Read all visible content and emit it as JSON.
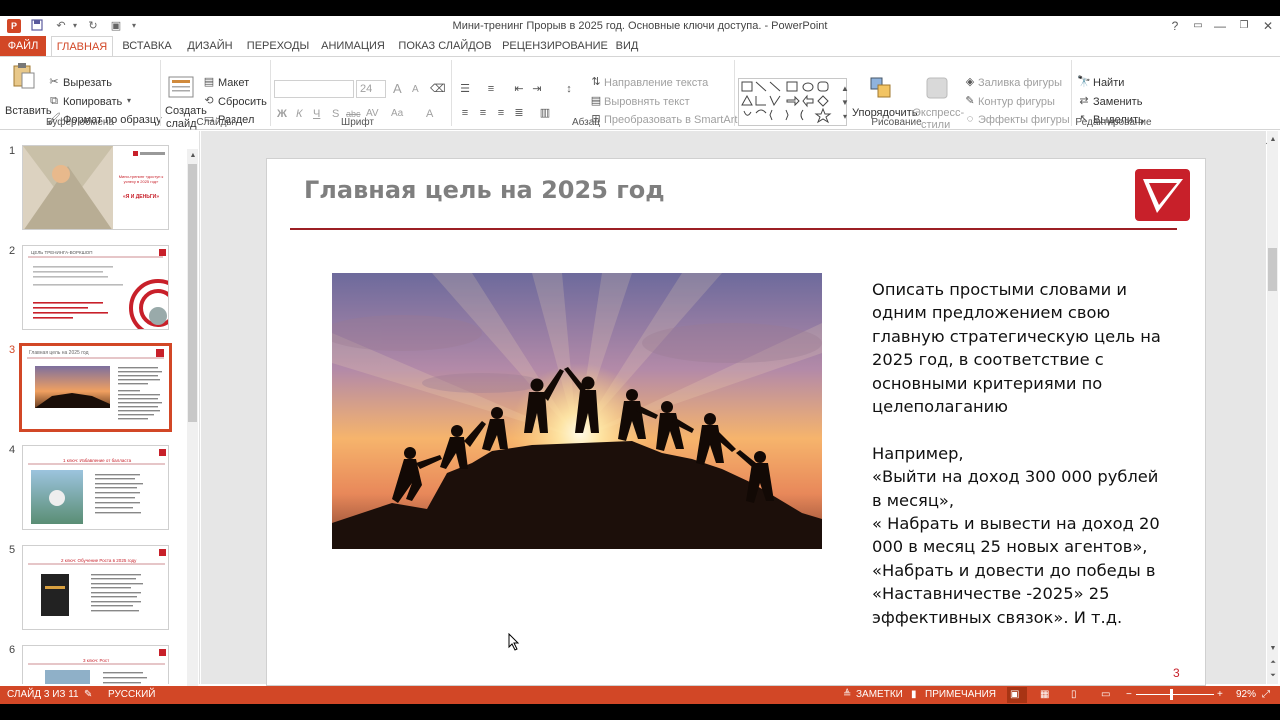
{
  "window": {
    "title": "Мини-тренинг Прорыв в 2025 год. Основные ключи доступа. - PowerPoint",
    "help": "?"
  },
  "tabs": {
    "file": "ФАЙЛ",
    "items": [
      "ГЛАВНАЯ",
      "ВСТАВКА",
      "ДИЗАЙН",
      "ПЕРЕХОДЫ",
      "АНИМАЦИЯ",
      "ПОКАЗ СЛАЙДОВ",
      "РЕЦЕНЗИРОВАНИЕ",
      "ВИД"
    ]
  },
  "ribbon": {
    "clipboard": {
      "paste": "Вставить",
      "cut": "Вырезать",
      "copy": "Копировать",
      "format_painter": "Формат по образцу",
      "label": "Буфер обмена"
    },
    "slides": {
      "new_slide_1": "Создать",
      "new_slide_2": "слайд",
      "layout": "Макет",
      "reset": "Сбросить",
      "section": "Раздел",
      "label": "Слайды"
    },
    "font": {
      "size": "24",
      "bold": "Ж",
      "italic": "К",
      "underline": "Ч",
      "shadow": "S",
      "strike": "abc",
      "spacing": "AV",
      "case": "Aa",
      "color": "A",
      "grow": "A",
      "shrink": "A",
      "label": "Шрифт"
    },
    "paragraph": {
      "text_direction": "Направление текста",
      "align_text": "Выровнять текст",
      "smartart": "Преобразовать в SmartArt",
      "label": "Абзац"
    },
    "drawing": {
      "arrange": "Упорядочить",
      "quick_styles_1": "Экспресс-",
      "quick_styles_2": "стили",
      "shape_fill": "Заливка фигуры",
      "shape_outline": "Контур фигуры",
      "shape_effects": "Эффекты фигуры",
      "label": "Рисование"
    },
    "editing": {
      "find": "Найти",
      "replace": "Заменить",
      "select": "Выделить",
      "label": "Редактирование"
    }
  },
  "thumbnails": {
    "numbers": [
      "1",
      "2",
      "3",
      "4",
      "5",
      "6"
    ],
    "active_index": 3,
    "t1": {
      "heading": "Мини-тренинг «доступ к успеху в 2025 год»",
      "caption": "«Я И ДЕНЬГИ»"
    },
    "t2": {
      "heading": "ЦЕЛЬ ТРЕНИНГА-ВОРКШОП"
    },
    "t3": {
      "heading": "Главная цель на 2025 год"
    },
    "t4": {
      "heading": "1 ключ: Избавление от балласта"
    },
    "t5": {
      "heading": "2 ключ: Обучение Роста в 2025 году"
    },
    "t6": {
      "heading": "3 ключ: Рост"
    }
  },
  "slide": {
    "title": "Главная цель на 2025 год",
    "body": "Описать простыми словами и одним предложением свою главную стратегическую цель на 2025 год, в соответствие с основными критериями по целеполаганию\n\nНапример,\n «Выйти на доход 300 000 рублей в месяц»,\n« Набрать и вывести на доход 20 000 в месяц 25 новых агентов»,\n«Набрать и довести до победы в «Наставничестве -2025» 25 эффективных связок». И т.д.",
    "number": "3"
  },
  "status": {
    "slide_of": "СЛАЙД 3 ИЗ 11",
    "language": "РУССКИЙ",
    "notes": "ЗАМЕТКИ",
    "comments": "ПРИМЕЧАНИЯ",
    "zoom": "92%"
  },
  "colors": {
    "accent": "#d24726",
    "slide_red": "#c8202a",
    "title_gray": "#7f7f7f"
  }
}
